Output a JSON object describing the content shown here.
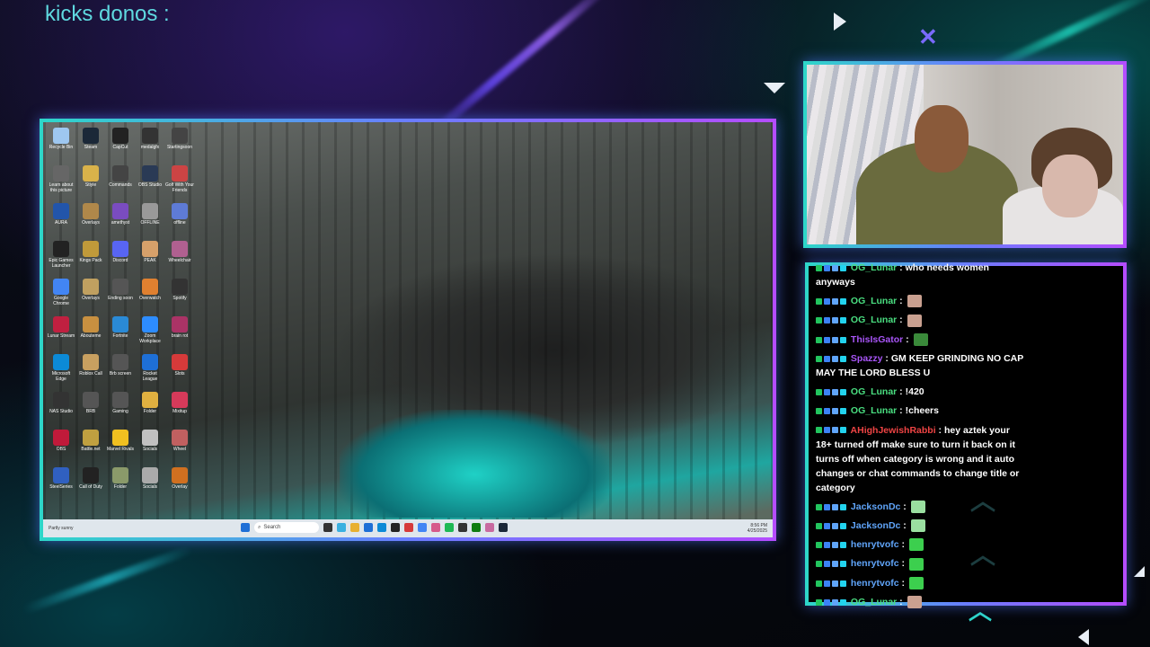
{
  "overlay": {
    "title": "kicks donos :"
  },
  "desktop": {
    "icons": [
      {
        "label": "Recycle Bin",
        "color": "#9ec7f0"
      },
      {
        "label": "Steam",
        "color": "#1b2838"
      },
      {
        "label": "CapCut",
        "color": "#222222"
      },
      {
        "label": "medalgfx",
        "color": "#333333"
      },
      {
        "label": "Startingsoon",
        "color": "#444444"
      },
      {
        "label": "Learn about this picture",
        "color": "#666666"
      },
      {
        "label": "Stiyle",
        "color": "#d9b24a"
      },
      {
        "label": "Commands",
        "color": "#444444"
      },
      {
        "label": "OBS Studio",
        "color": "#2a3a55"
      },
      {
        "label": "Golf With Your Friends",
        "color": "#cc4444"
      },
      {
        "label": "AURA",
        "color": "#2255aa"
      },
      {
        "label": "Overlays",
        "color": "#b0884a"
      },
      {
        "label": "amethyst",
        "color": "#7a4cc0"
      },
      {
        "label": "OFFLINE",
        "color": "#999999"
      },
      {
        "label": "offline",
        "color": "#5e7bd6"
      },
      {
        "label": "Epic Games Launcher",
        "color": "#222222"
      },
      {
        "label": "Kings Pack",
        "color": "#c09a3a"
      },
      {
        "label": "Discord",
        "color": "#5865f2"
      },
      {
        "label": "PEAK",
        "color": "#d6a06a"
      },
      {
        "label": "Wheelchair",
        "color": "#b06090"
      },
      {
        "label": "Google Chrome",
        "color": "#4285f4"
      },
      {
        "label": "Overlays",
        "color": "#c0a060"
      },
      {
        "label": "Ending soon",
        "color": "#555555"
      },
      {
        "label": "Overwatch",
        "color": "#e08030"
      },
      {
        "label": "Spotify",
        "color": "#333333"
      },
      {
        "label": "Lunar Stream",
        "color": "#c02040"
      },
      {
        "label": "Abouteme",
        "color": "#c89040"
      },
      {
        "label": "Fortnite",
        "color": "#2a8ad6"
      },
      {
        "label": "Zoom Workplace",
        "color": "#2d8cff"
      },
      {
        "label": "brain rot",
        "color": "#aa3366"
      },
      {
        "label": "Microsoft Edge",
        "color": "#0c8ad6"
      },
      {
        "label": "Roblox Call",
        "color": "#c8a060"
      },
      {
        "label": "Brb screen",
        "color": "#555555"
      },
      {
        "label": "Rocket League",
        "color": "#1e6fd6"
      },
      {
        "label": "Slots",
        "color": "#d63a3a"
      },
      {
        "label": "NAS Studio",
        "color": "#333333"
      },
      {
        "label": "BRB",
        "color": "#555555"
      },
      {
        "label": "Gaming",
        "color": "#555555"
      },
      {
        "label": "Folder",
        "color": "#e0b040"
      },
      {
        "label": "Mixitup",
        "color": "#d63a5a"
      },
      {
        "label": "OBS",
        "color": "#c01a3a"
      },
      {
        "label": "Battle.net",
        "color": "#c0a040"
      },
      {
        "label": "Marvel Rivals",
        "color": "#f0c020"
      },
      {
        "label": "Socials",
        "color": "#c0c0c0"
      },
      {
        "label": "Wheel",
        "color": "#c06060"
      },
      {
        "label": "SteelSeries",
        "color": "#3060c0"
      },
      {
        "label": "Call of Duty",
        "color": "#222222"
      },
      {
        "label": "Folder",
        "color": "#8a9a6a"
      },
      {
        "label": "Socials",
        "color": "#aaaaaa"
      },
      {
        "label": "Overlay",
        "color": "#d07020"
      }
    ],
    "taskbar": {
      "weather": "Partly sunny",
      "search_placeholder": "Search",
      "time": "8:56 PM",
      "date": "4/25/2025"
    }
  },
  "chat": {
    "messages": [
      {
        "user": "OG_Lunar",
        "color": "#4ade80",
        "text": "who needs women anyways",
        "emote": null,
        "partial": true
      },
      {
        "user": "OG_Lunar",
        "color": "#4ade80",
        "text": "",
        "emote": "face"
      },
      {
        "user": "OG_Lunar",
        "color": "#4ade80",
        "text": "",
        "emote": "face"
      },
      {
        "user": "ThisIsGator",
        "color": "#a855f7",
        "text": "",
        "emote": "gator"
      },
      {
        "user": "Spazzy",
        "color": "#a855f7",
        "text": "GM KEEP GRINDING NO CAP MAY THE LORD BLESS U",
        "emote": null
      },
      {
        "user": "OG_Lunar",
        "color": "#4ade80",
        "text": "!420",
        "emote": null
      },
      {
        "user": "OG_Lunar",
        "color": "#4ade80",
        "text": "!cheers",
        "emote": null
      },
      {
        "user": "AHighJewishRabbi",
        "color": "#ef4444",
        "text": "hey aztek your 18+ turned off make sure to turn it back on it turns off when category is wrong and it auto changes or chat commands to change title or category",
        "emote": null
      },
      {
        "user": "JacksonDc",
        "color": "#60a5fa",
        "text": "",
        "emote": "heart"
      },
      {
        "user": "JacksonDc",
        "color": "#60a5fa",
        "text": "",
        "emote": "heart"
      },
      {
        "user": "henrytvofc",
        "color": "#60a5fa",
        "text": "",
        "emote": "green"
      },
      {
        "user": "henrytvofc",
        "color": "#60a5fa",
        "text": "",
        "emote": "green"
      },
      {
        "user": "henrytvofc",
        "color": "#60a5fa",
        "text": "",
        "emote": "green"
      },
      {
        "user": "OG_Lunar",
        "color": "#4ade80",
        "text": "",
        "emote": "face"
      }
    ]
  }
}
